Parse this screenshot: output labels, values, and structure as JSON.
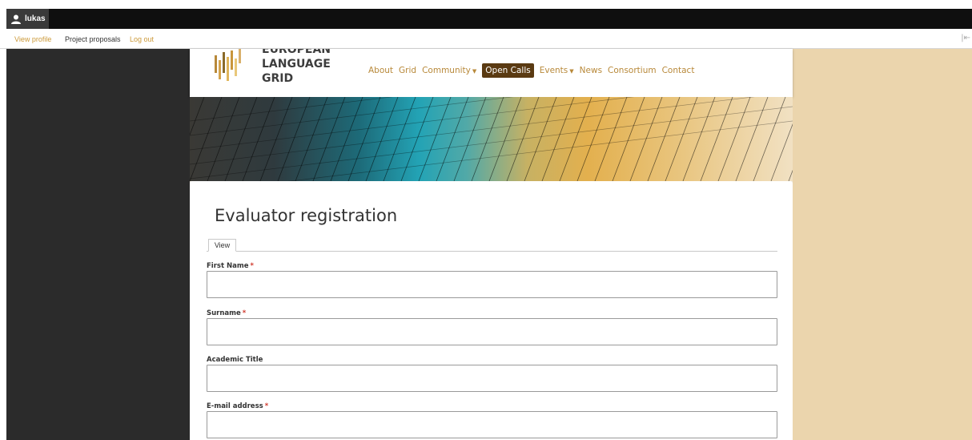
{
  "toolbar": {
    "user_name": "lukas",
    "links": [
      "View profile",
      "Project proposals",
      "Log out"
    ]
  },
  "site": {
    "logo_lines": [
      "EUROPEAN",
      "LANGUAGE",
      "GRID"
    ],
    "nav": [
      {
        "label": "About",
        "dropdown": false,
        "active": false
      },
      {
        "label": "Grid",
        "dropdown": false,
        "active": false
      },
      {
        "label": "Community",
        "dropdown": true,
        "active": false
      },
      {
        "label": "Open Calls",
        "dropdown": false,
        "active": true
      },
      {
        "label": "Events",
        "dropdown": true,
        "active": false
      },
      {
        "label": "News",
        "dropdown": false,
        "active": false
      },
      {
        "label": "Consortium",
        "dropdown": false,
        "active": false
      },
      {
        "label": "Contact",
        "dropdown": false,
        "active": false
      }
    ]
  },
  "page": {
    "title": "Evaluator registration",
    "tab": "View",
    "fields": [
      {
        "label": "First Name",
        "required": true,
        "value": ""
      },
      {
        "label": "Surname",
        "required": true,
        "value": ""
      },
      {
        "label": "Academic Title",
        "required": false,
        "value": ""
      },
      {
        "label": "E-mail address",
        "required": true,
        "value": ""
      }
    ]
  },
  "colors": {
    "accent": "#cc9a3a",
    "nav_link": "#b8893a",
    "active_nav_bg": "#5a3a12",
    "required_star": "#d0372a",
    "left_backdrop": "#2b2b2b",
    "right_backdrop": "#ebd5ad"
  }
}
